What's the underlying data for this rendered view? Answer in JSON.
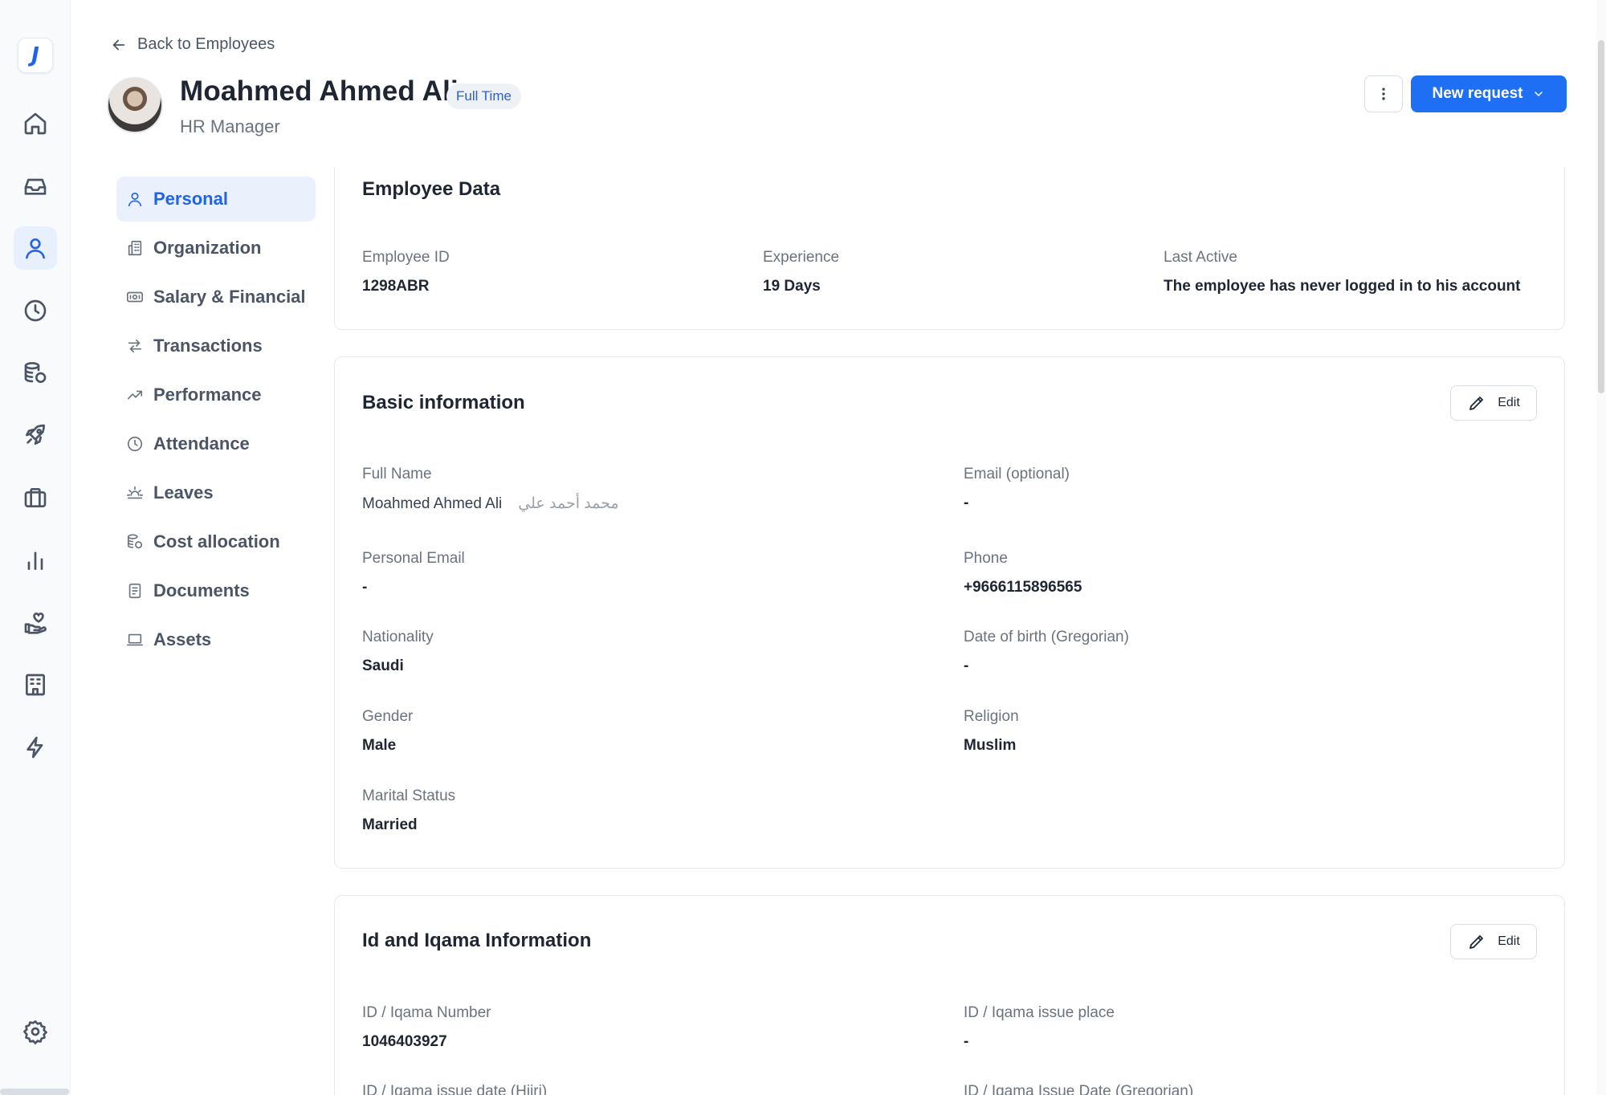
{
  "rail": {
    "logo": "J",
    "icons": [
      "home-icon",
      "inbox-icon",
      "user-icon",
      "clock-icon",
      "database-icon",
      "rocket-icon",
      "briefcase-icon",
      "chart-icon",
      "hand-heart-icon",
      "building-icon",
      "lightning-icon",
      "settings-icon"
    ],
    "active": "user-icon"
  },
  "header": {
    "back_label": "Back to Employees",
    "name": "Moahmed Ahmed Ali",
    "badge": "Full Time",
    "role": "HR Manager",
    "new_request_label": "New request"
  },
  "subnav": {
    "items": [
      {
        "label": "Personal",
        "icon": "user-icon",
        "active": true
      },
      {
        "label": "Organization",
        "icon": "building-icon"
      },
      {
        "label": "Salary & Financial",
        "icon": "money-icon"
      },
      {
        "label": "Transactions",
        "icon": "transfer-icon"
      },
      {
        "label": "Performance",
        "icon": "trend-icon"
      },
      {
        "label": "Attendance",
        "icon": "clock-icon"
      },
      {
        "label": "Leaves",
        "icon": "sunset-icon"
      },
      {
        "label": "Cost allocation",
        "icon": "coins-icon"
      },
      {
        "label": "Documents",
        "icon": "document-icon"
      },
      {
        "label": "Assets",
        "icon": "laptop-icon"
      }
    ]
  },
  "employee_data": {
    "title": "Employee Data",
    "employee_id_label": "Employee ID",
    "employee_id": "1298ABR",
    "experience_label": "Experience",
    "experience": "19 Days",
    "last_active_label": "Last Active",
    "last_active": "The employee has never logged in to his account"
  },
  "basic_info": {
    "title": "Basic information",
    "edit_label": "Edit",
    "full_name_label": "Full Name",
    "full_name": "Moahmed Ahmed Ali",
    "full_name_ar": "محمد أحمد علي",
    "email_label": "Email (optional)",
    "email": "-",
    "personal_email_label": "Personal Email",
    "personal_email": "-",
    "phone_label": "Phone",
    "phone": "+9666115896565",
    "nationality_label": "Nationality",
    "nationality": "Saudi",
    "dob_label": "Date of birth (Gregorian)",
    "dob": "-",
    "gender_label": "Gender",
    "gender": "Male",
    "religion_label": "Religion",
    "religion": "Muslim",
    "marital_label": "Marital Status",
    "marital": "Married"
  },
  "id_info": {
    "title": "Id and Iqama Information",
    "edit_label": "Edit",
    "id_number_label": "ID / Iqama Number",
    "id_number": "1046403927",
    "issue_place_label": "ID / Iqama issue place",
    "issue_place": "-",
    "issue_date_hijri_label": "ID / Iqama issue date (Hijri)",
    "issue_date_greg_label": "ID / Iqama Issue Date (Gregorian)"
  }
}
